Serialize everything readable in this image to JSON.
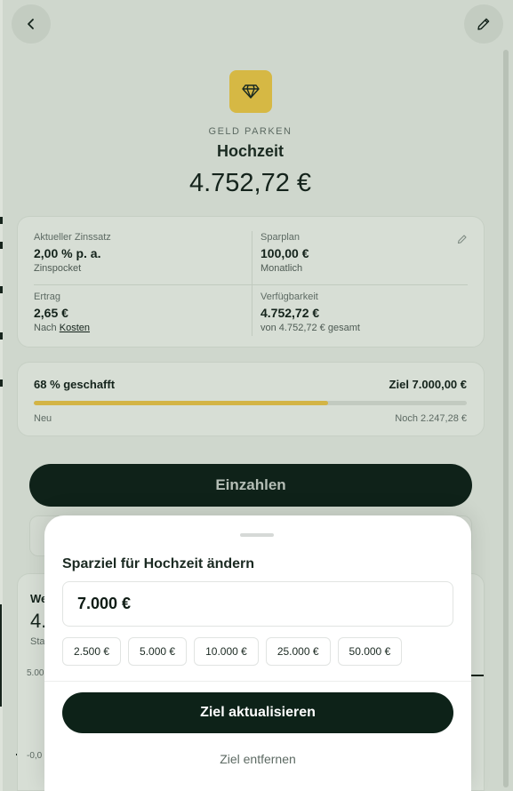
{
  "header": {
    "back_icon": "chevron-left-icon",
    "edit_icon": "pencil-icon"
  },
  "goal": {
    "icon": "diamond-icon",
    "category": "GELD PARKEN",
    "name": "Hochzeit",
    "balance": "4.752,72 €",
    "accent_color": "#d6b844"
  },
  "info": {
    "rate_label": "Aktueller Zinssatz",
    "rate_value": "2,00 % p. a.",
    "rate_sub": "Zinspocket",
    "plan_label": "Sparplan",
    "plan_value": "100,00 €",
    "plan_sub": "Monatlich",
    "yield_label": "Ertrag",
    "yield_value": "2,65 €",
    "yield_sub_prefix": "Nach",
    "yield_sub_link": "Kosten",
    "avail_label": "Verfügbarkeit",
    "avail_value": "4.752,72 €",
    "avail_sub": "von 4.752,72 € gesamt"
  },
  "progress": {
    "percent_label": "68 % geschafft",
    "goal_label": "Ziel 7.000,00 €",
    "fraction": 0.68,
    "status": "Neu",
    "remaining": "Noch 2.247,28 €"
  },
  "deposit_button": "Einzahlen",
  "chart_peek": {
    "label_a": "We",
    "label_b": "4.",
    "label_c": "Sta",
    "tick_top": "5.00",
    "tick_bottom": "-0,0"
  },
  "sheet": {
    "title": "Sparziel für Hochzeit ändern",
    "amount_value": "7.000 €",
    "presets": [
      "2.500 €",
      "5.000 €",
      "10.000 €",
      "25.000 €",
      "50.000 €"
    ],
    "submit_label": "Ziel aktualisieren",
    "remove_label": "Ziel entfernen"
  }
}
